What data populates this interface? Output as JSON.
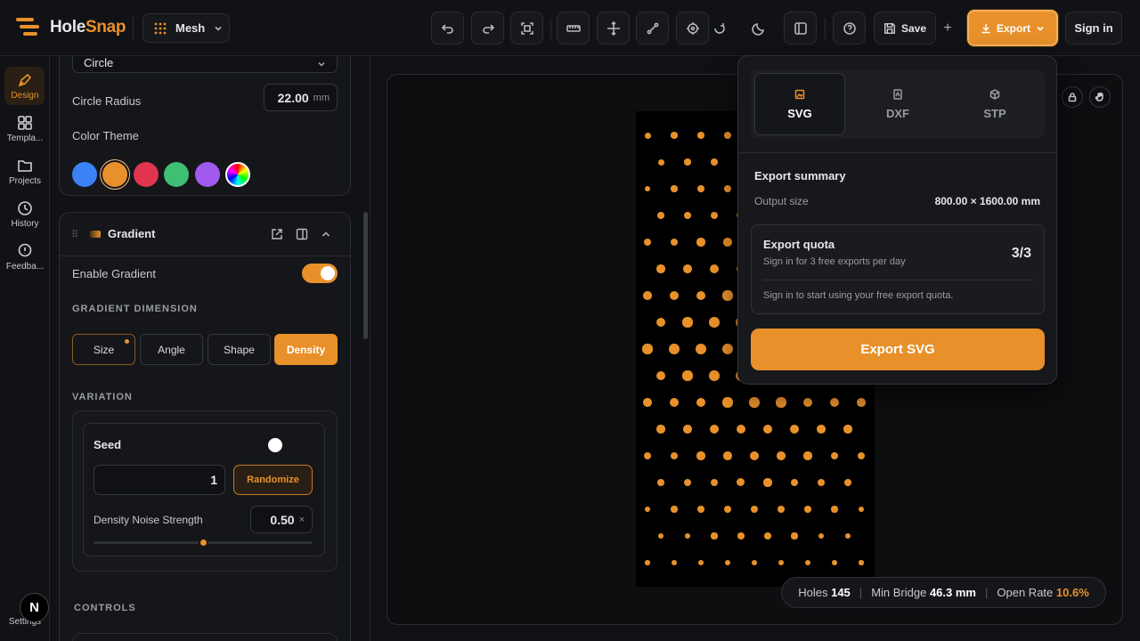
{
  "app": {
    "name_part1": "Hole",
    "name_part2": "Snap"
  },
  "header": {
    "mode_label": "Mesh",
    "save_label": "Save",
    "plus_label": "+",
    "export_label": "Export",
    "signin_label": "Sign in"
  },
  "rail": {
    "items": [
      {
        "label": "Design",
        "icon": "pen-icon"
      },
      {
        "label": "Templa...",
        "icon": "grid-icon"
      },
      {
        "label": "Projects",
        "icon": "folder-icon"
      },
      {
        "label": "History",
        "icon": "history-icon"
      },
      {
        "label": "Feedba...",
        "icon": "message-icon"
      }
    ],
    "settings_label": "Settings",
    "avatar_letter": "N"
  },
  "panel": {
    "shape_select_value": "Circle",
    "circle_radius_label": "Circle Radius",
    "circle_radius_value": "22.00",
    "circle_radius_unit": "mm",
    "color_theme_label": "Color Theme",
    "color_swatches": [
      "#3b82f6",
      "#e8912b",
      "#e0344f",
      "#3fbf73",
      "#a259f0",
      "rainbow"
    ],
    "selected_swatch": "#e8912b",
    "gradient": {
      "title": "Gradient",
      "enable_label": "Enable Gradient",
      "enabled": true,
      "dimension_title": "GRADIENT DIMENSION",
      "dimensions": [
        "Size",
        "Angle",
        "Shape",
        "Density"
      ],
      "active_dimension": "Density",
      "variation_title": "VARIATION",
      "seed_label": "Seed",
      "seed_value": "1",
      "randomize_label": "Randomize",
      "noise_label": "Density Noise Strength",
      "noise_value": "0.50",
      "noise_unit": "×",
      "noise_fraction": 0.5
    },
    "controls_title": "CONTROLS"
  },
  "stats": {
    "holes_label": "Holes",
    "holes_value": "145",
    "bridge_label": "Min Bridge",
    "bridge_value": "46.3 mm",
    "open_label": "Open Rate",
    "open_value": "10.6%"
  },
  "export_popover": {
    "formats": [
      "SVG",
      "DXF",
      "STP"
    ],
    "active_format": "SVG",
    "summary_title": "Export summary",
    "output_size_label": "Output size",
    "output_size_value": "800.00 × 1600.00 mm",
    "quota_title": "Export quota",
    "quota_subtitle": "Sign in for 3 free exports per day",
    "quota_value": "3/3",
    "quota_note": "Sign in to start using your free export quota.",
    "export_button_label": "Export SVG"
  },
  "colors": {
    "accent": "#e8912b",
    "background": "#101114"
  }
}
